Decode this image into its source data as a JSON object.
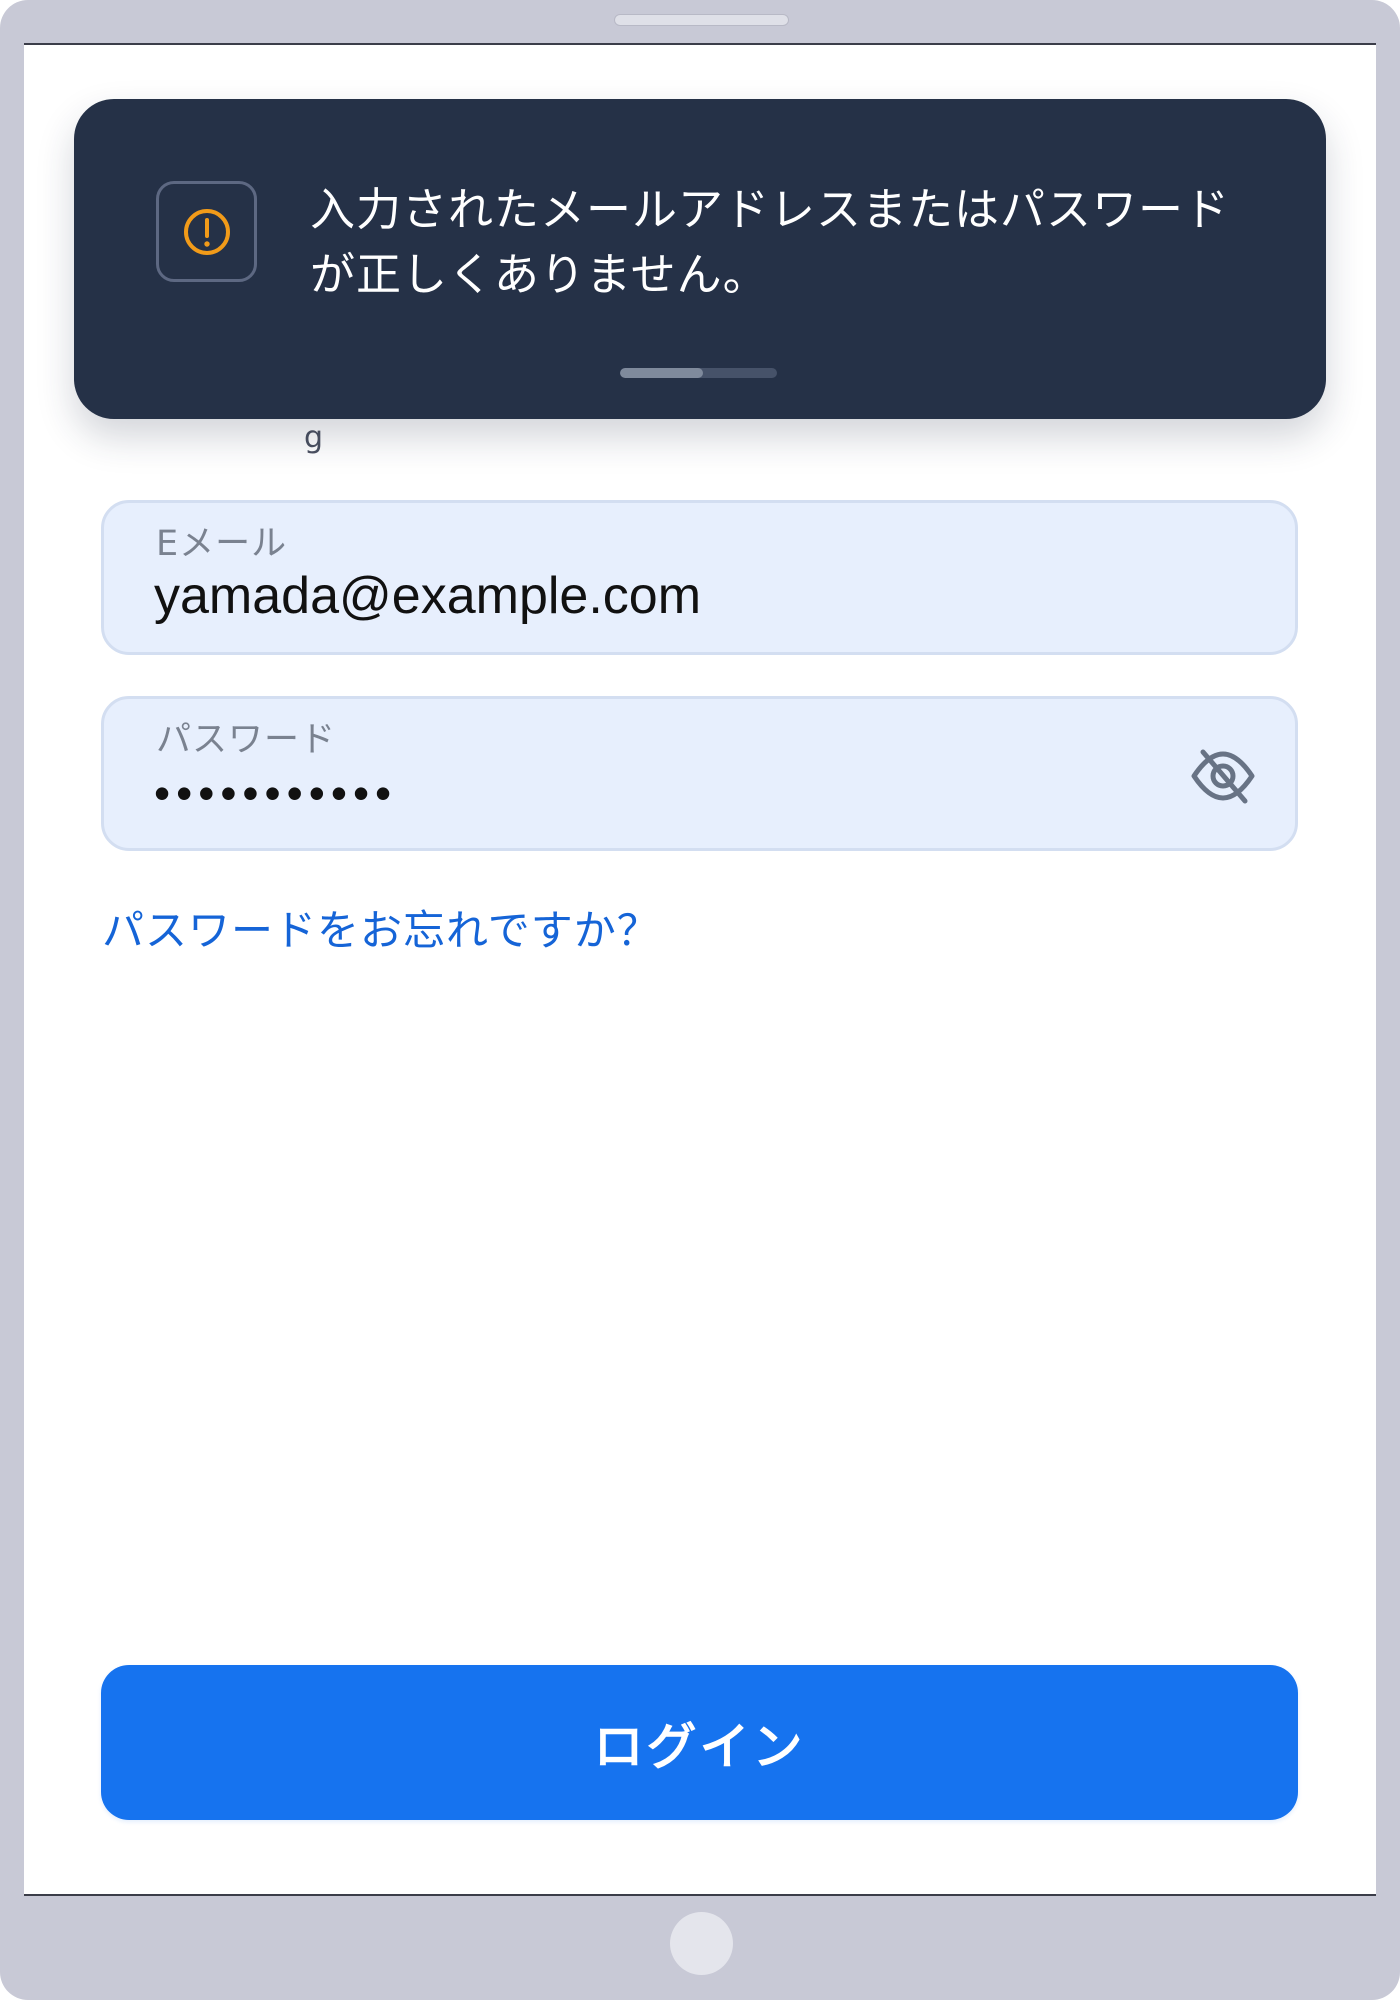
{
  "toast": {
    "icon": "alert-circle-icon",
    "message": "入力されたメールアドレスまたはパスワード\nが正しくありません。",
    "progress_fraction": 0.53
  },
  "form": {
    "email": {
      "label": "Eメール",
      "value": "yamada@example.com"
    },
    "password": {
      "label": "パスワード",
      "value": "•••••••••••",
      "visibility_icon": "eye-off-icon"
    },
    "forgot_password": "パスワードをお忘れですか？",
    "submit": "ログイン"
  },
  "colors": {
    "toast_background": "#253147",
    "warning": "#f29b19",
    "link": "#1564d7",
    "primary_button": "#1673ef",
    "field_background": "#e7effd"
  }
}
